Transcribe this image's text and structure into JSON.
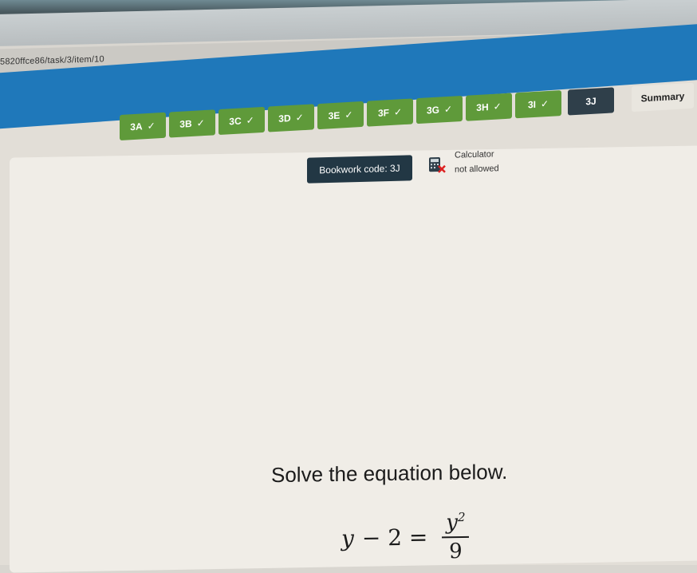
{
  "browser": {
    "url": "5820ffce86/task/3/item/10"
  },
  "nav": {
    "tabs": [
      {
        "label": "3A",
        "done": true
      },
      {
        "label": "3B",
        "done": true
      },
      {
        "label": "3C",
        "done": true
      },
      {
        "label": "3D",
        "done": true
      },
      {
        "label": "3E",
        "done": true
      },
      {
        "label": "3F",
        "done": true
      },
      {
        "label": "3G",
        "done": true
      },
      {
        "label": "3H",
        "done": true
      },
      {
        "label": "3I",
        "done": true
      },
      {
        "label": "3J",
        "done": false
      }
    ],
    "summary_label": "Summary",
    "check": "✓"
  },
  "task": {
    "bookwork_label": "Bookwork code: 3J",
    "calculator_label": "Calculator",
    "calculator_status": "not allowed"
  },
  "question": {
    "prompt": "Solve the equation below.",
    "lhs_var": "y",
    "lhs_rest": "− 2 =",
    "rhs_num_var": "y",
    "rhs_num_exp": "2",
    "rhs_den": "9"
  },
  "colors": {
    "blue_band": "#1f78ba",
    "tab_done": "#5f9a3a",
    "tab_dark": "#2f3f4a",
    "bookwork_bg": "#223744"
  }
}
